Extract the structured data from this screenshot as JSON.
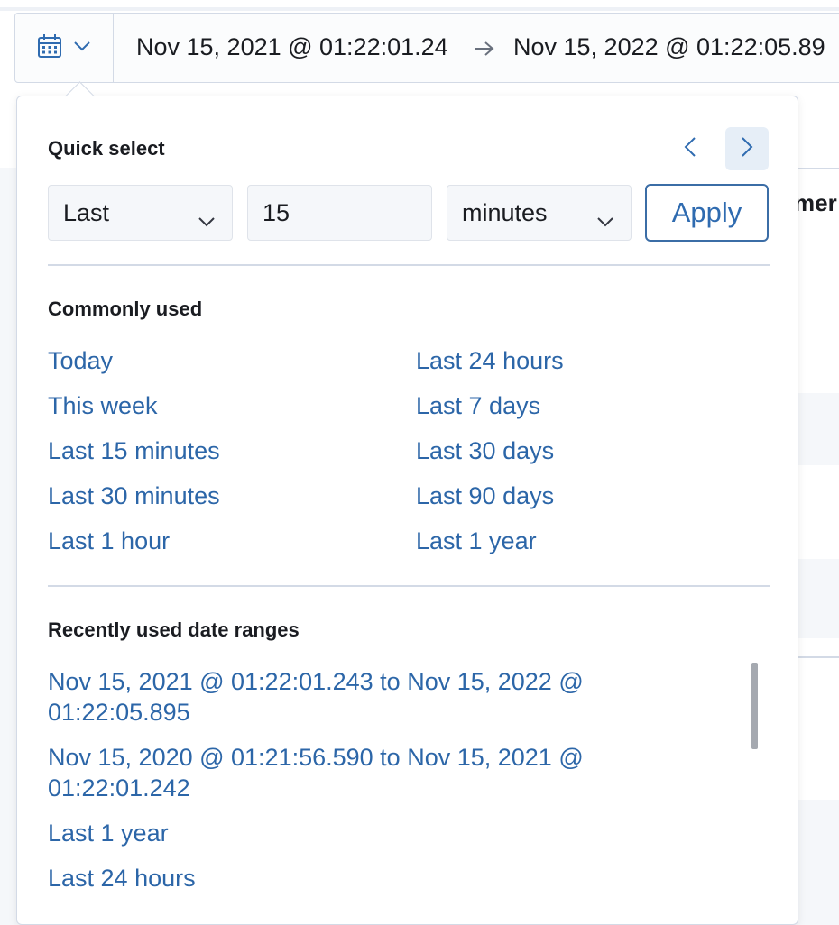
{
  "datebar": {
    "start": "Nov 15, 2021 @ 01:22:01.24",
    "end": "Nov 15, 2022 @ 01:22:05.89",
    "calendar_icon": "calendar-icon",
    "arrow_icon": "arrow-right-icon"
  },
  "background": {
    "peek_text": "mer"
  },
  "quick_select": {
    "title": "Quick select",
    "direction": "Last",
    "value": "15",
    "unit": "minutes",
    "apply_label": "Apply"
  },
  "commonly_used": {
    "title": "Commonly used",
    "left": [
      "Today",
      "This week",
      "Last 15 minutes",
      "Last 30 minutes",
      "Last 1 hour"
    ],
    "right": [
      "Last 24 hours",
      "Last 7 days",
      "Last 30 days",
      "Last 90 days",
      "Last 1 year"
    ]
  },
  "recent": {
    "title": "Recently used date ranges",
    "items": [
      "Nov 15, 2021 @ 01:22:01.243 to Nov 15, 2022 @ 01:22:05.895",
      "Nov 15, 2020 @ 01:21:56.590 to Nov 15, 2021 @ 01:22:01.242",
      "Last 1 year",
      "Last 24 hours"
    ]
  },
  "colors": {
    "link": "#2c66a8",
    "border": "#d3dae6",
    "accent": "#3b6da6"
  }
}
